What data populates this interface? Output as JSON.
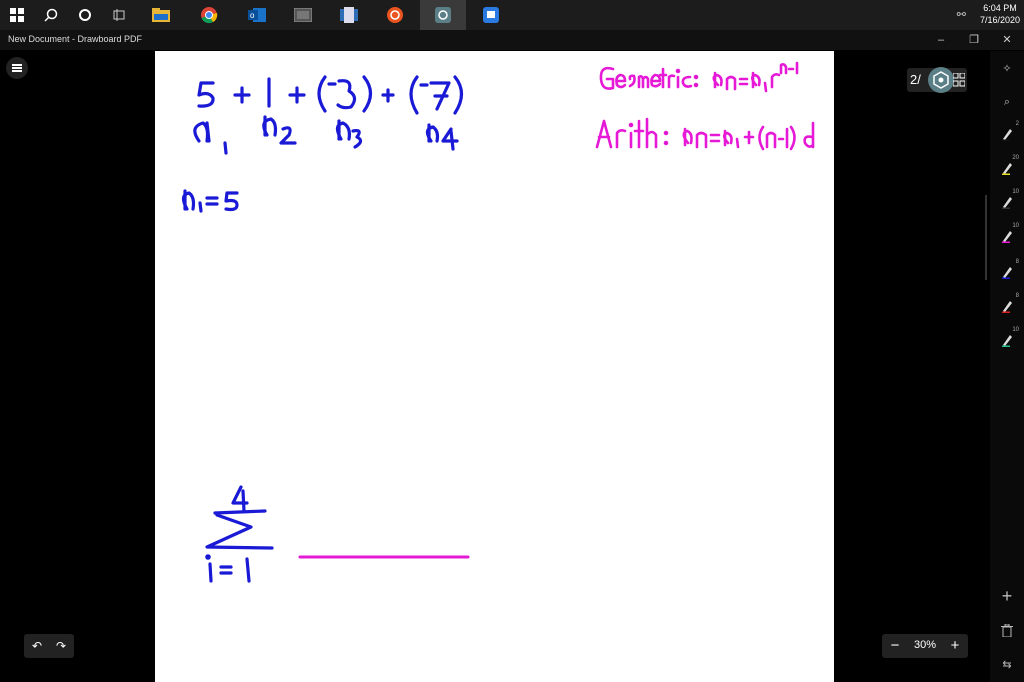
{
  "taskbar": {
    "time": "6:04 PM",
    "date": "7/16/2020",
    "icons": [
      "windows-icon",
      "search-icon",
      "cortana-icon",
      "task-view-icon",
      "file-explorer-icon",
      "chrome-icon",
      "outlook-icon",
      "onscreen-keyboard-icon",
      "document-icon",
      "ubuntu-icon",
      "drawboard-icon",
      "app-icon"
    ]
  },
  "window": {
    "title": "New Document - Drawboard PDF"
  },
  "page_counter": {
    "value": "2/"
  },
  "zoom": {
    "label": "30%",
    "minus": "−",
    "plus": "+"
  },
  "toolbar_sizes": [
    "2",
    "20",
    "10",
    "10",
    "8",
    "8",
    "10"
  ],
  "ink_colors": {
    "blue": "#1a1ad6",
    "magenta": "#e619d6"
  }
}
